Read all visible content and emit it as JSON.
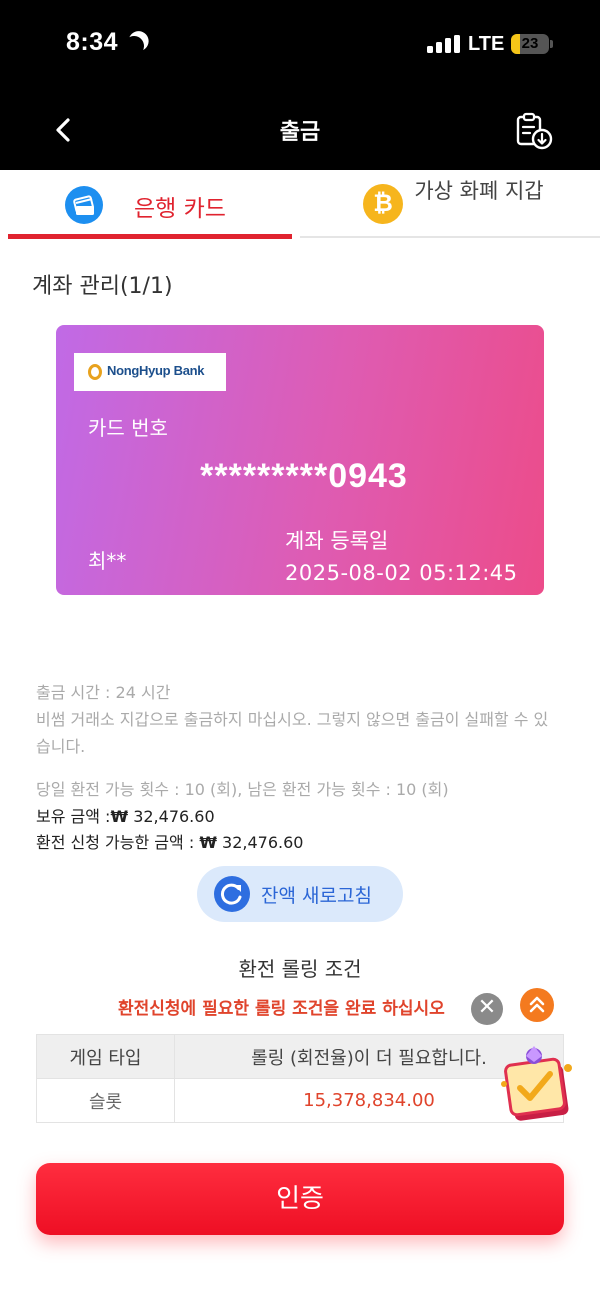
{
  "status_bar": {
    "time": "8:34",
    "network": "LTE",
    "battery": "23",
    "battery_level": 0.23
  },
  "header": {
    "title": "출금"
  },
  "tabs": [
    {
      "label": "은행 카드",
      "active": true
    },
    {
      "label": "가상 화폐 지갑",
      "active": false
    }
  ],
  "account": {
    "title": "계좌 관리(1/1)",
    "card": {
      "bank_name": "NongHyup Bank",
      "number_label": "카드 번호",
      "number": "*********0943",
      "holder": "최**",
      "register_label": "계좌 등록일",
      "register_date": "2025-08-02 05:12:45"
    }
  },
  "info": {
    "withdraw_time": "출금 시간 :  24 시간",
    "warning": "비썸 거래소 지갑으로 출금하지 마십시오. 그렇지 않으면 출금이 실패할 수 있습니다.",
    "exchange_count": "당일 환전 가능 횟수 : 10 (회), 남은 환전 가능 횟수 : 10 (회)",
    "balance_label": "보유 금액 :",
    "currency": "₩",
    "balance_value": " 32,476.60",
    "available_label": "환전 신청 가능한 금액 : ",
    "available_value": " 32,476.60"
  },
  "refresh_button": {
    "label": "잔액 새로고침"
  },
  "rolling": {
    "title": "환전 롤링 조건",
    "warning": "환전신청에 필요한 롤링 조건을 완료 하십시오",
    "columns": [
      "게임 타입",
      "롤링 (회전율)이 더 필요합니다."
    ],
    "rows": [
      {
        "type": "슬롯",
        "amount": "15,378,834.00"
      }
    ]
  },
  "confirm_button": {
    "label": "인증"
  },
  "colors": {
    "accent": "#e0232f",
    "card_start": "#c06ae6",
    "card_end": "#ec4c8a",
    "refresh_bg": "#dbe9fb"
  },
  "icons": [
    "moon-icon",
    "signal-icon",
    "battery-icon",
    "back-icon",
    "history-icon",
    "bank-card-icon",
    "bitcoin-icon",
    "refresh-icon",
    "close-icon",
    "chevron-up-icon",
    "gift-icon"
  ]
}
